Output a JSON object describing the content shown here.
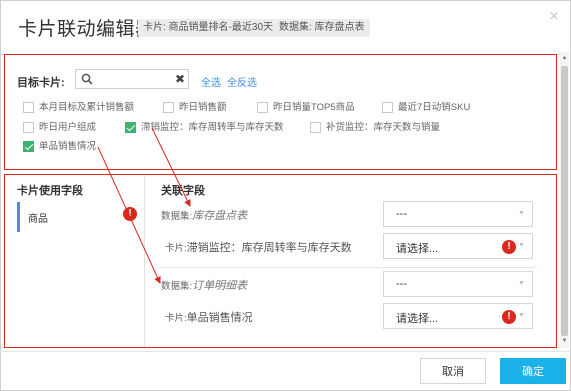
{
  "header": {
    "title": "卡片联动编辑器",
    "card_tag": "卡片: 商品销量排名-最近30天",
    "dataset_tag": "数据集: 库存盘点表",
    "close_glyph": "×"
  },
  "card_select": {
    "label": "目标卡片:",
    "search_value": "",
    "clear_glyph": "✖",
    "select_all": "全选",
    "invert": "全反选",
    "options": [
      {
        "label": "本月目标及累计销售额",
        "checked": false
      },
      {
        "label": "昨日销售额",
        "checked": false
      },
      {
        "label": "昨日销量TOP5商品",
        "checked": false
      },
      {
        "label": "最近7日动销SKU",
        "checked": false
      },
      {
        "label": "昨日用户组成",
        "checked": false
      },
      {
        "label": "滞销监控：库存周转率与库存天数",
        "checked": true
      },
      {
        "label": "补货监控：库存天数与销量",
        "checked": false
      },
      {
        "label": "单品销售情况",
        "checked": true
      }
    ]
  },
  "mapping": {
    "left_title": "卡片使用字段",
    "right_title": "关联字段",
    "field": "商品",
    "rows": [
      {
        "prefix": "数据集:",
        "name": "库存盘点表",
        "select_value": "---",
        "has_error": false
      },
      {
        "prefix": "卡片:",
        "name": "滞销监控：库存周转率与库存天数",
        "select_value": "请选择...",
        "has_error": true
      },
      {
        "prefix": "数据集:",
        "name": "订单明细表",
        "select_value": "---",
        "has_error": false
      },
      {
        "prefix": "卡片:",
        "name": "单品销售情况",
        "select_value": "请选择...",
        "has_error": true
      }
    ]
  },
  "footer": {
    "cancel": "取消",
    "ok": "确定"
  },
  "colors": {
    "accent": "#1ab0e8",
    "highlight": "#d9281e",
    "check": "#3cb371",
    "link": "#3a8ee6"
  }
}
